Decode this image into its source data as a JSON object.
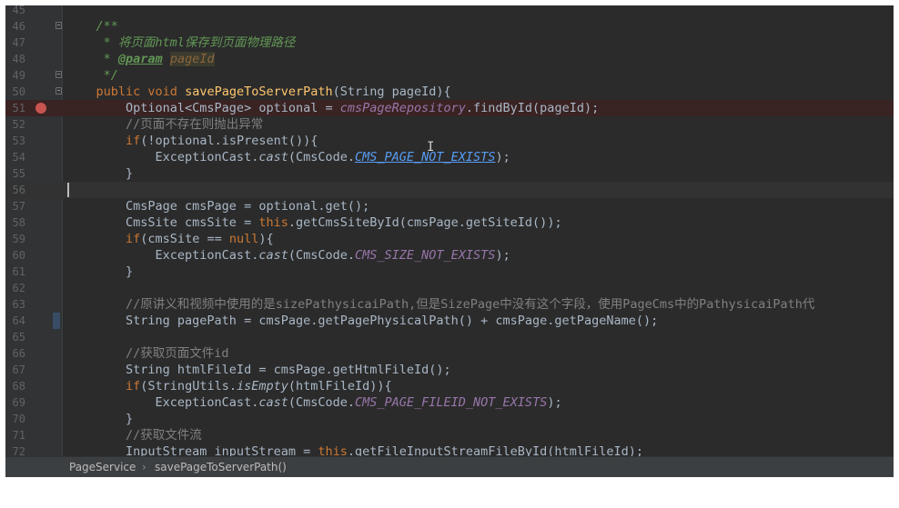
{
  "editor": {
    "lines": [
      {
        "n": "45",
        "tokens": []
      },
      {
        "n": "46",
        "tokens": [
          [
            "    ",
            ""
          ],
          [
            "/**",
            "doc"
          ]
        ]
      },
      {
        "n": "47",
        "tokens": [
          [
            "     ",
            ""
          ],
          [
            "* 将页面html保存到页面物理路径",
            "doc"
          ]
        ]
      },
      {
        "n": "48",
        "tokens": [
          [
            "     ",
            ""
          ],
          [
            "* ",
            "doc"
          ],
          [
            "@param",
            "doc-tag"
          ],
          [
            " ",
            "doc"
          ],
          [
            "pageId",
            "doc-param"
          ]
        ]
      },
      {
        "n": "49",
        "tokens": [
          [
            "     ",
            ""
          ],
          [
            "*/",
            "doc"
          ]
        ]
      },
      {
        "n": "50",
        "tokens": [
          [
            "    ",
            ""
          ],
          [
            "public void ",
            "kw"
          ],
          [
            "savePageToServerPath",
            "fn"
          ],
          [
            "(String pageId){",
            ""
          ]
        ]
      },
      {
        "n": "51",
        "tokens": [
          [
            "        Optional<CmsPage> optional = ",
            ""
          ],
          [
            "cmsPageRepository",
            "st"
          ],
          [
            ".findById(pageId);",
            ""
          ]
        ]
      },
      {
        "n": "52",
        "tokens": [
          [
            "        ",
            ""
          ],
          [
            "//页面不存在则抛出异常",
            "cm"
          ]
        ]
      },
      {
        "n": "53",
        "tokens": [
          [
            "        ",
            ""
          ],
          [
            "if",
            "kw"
          ],
          [
            "(!optional.isPresent()){",
            ""
          ]
        ]
      },
      {
        "n": "54",
        "tokens": [
          [
            "            ExceptionCast.",
            ""
          ],
          [
            "cast",
            "it"
          ],
          [
            "(CmsCode.",
            ""
          ],
          [
            "CMS_PAGE_NOT_EXISTS",
            "st-link"
          ],
          [
            ");",
            ""
          ]
        ]
      },
      {
        "n": "55",
        "tokens": [
          [
            "        }",
            ""
          ]
        ]
      },
      {
        "n": "56",
        "tokens": []
      },
      {
        "n": "57",
        "tokens": [
          [
            "        CmsPage cmsPage = optional.get();",
            ""
          ]
        ]
      },
      {
        "n": "58",
        "tokens": [
          [
            "        CmsSite cmsSite = ",
            ""
          ],
          [
            "this",
            "kw"
          ],
          [
            ".getCmsSiteById(cmsPage.getSiteId());",
            ""
          ]
        ]
      },
      {
        "n": "59",
        "tokens": [
          [
            "        ",
            ""
          ],
          [
            "if",
            "kw"
          ],
          [
            "(cmsSite == ",
            ""
          ],
          [
            "null",
            "kw"
          ],
          [
            "){",
            ""
          ]
        ]
      },
      {
        "n": "60",
        "tokens": [
          [
            "            ExceptionCast.",
            ""
          ],
          [
            "cast",
            "it"
          ],
          [
            "(CmsCode.",
            ""
          ],
          [
            "CMS_SIZE_NOT_EXISTS",
            "st"
          ],
          [
            ");",
            ""
          ]
        ]
      },
      {
        "n": "61",
        "tokens": [
          [
            "        }",
            ""
          ]
        ]
      },
      {
        "n": "62",
        "tokens": []
      },
      {
        "n": "63",
        "tokens": [
          [
            "        ",
            ""
          ],
          [
            "//原讲义和视频中使用的是sizePathysicaiPath,但是SizePage中没有这个字段，使用PageCms中的PathysicaiPath代",
            "cm"
          ]
        ]
      },
      {
        "n": "64",
        "tokens": [
          [
            "        String pagePath = cmsPage.getPagePhysicalPath() + cmsPage.getPageName();",
            ""
          ]
        ]
      },
      {
        "n": "65",
        "tokens": []
      },
      {
        "n": "66",
        "tokens": [
          [
            "        ",
            ""
          ],
          [
            "//获取页面文件id",
            "cm"
          ]
        ]
      },
      {
        "n": "67",
        "tokens": [
          [
            "        String htmlFileId = cmsPage.getHtmlFileId();",
            ""
          ]
        ]
      },
      {
        "n": "68",
        "tokens": [
          [
            "        ",
            ""
          ],
          [
            "if",
            "kw"
          ],
          [
            "(StringUtils.",
            ""
          ],
          [
            "isEmpty",
            "it"
          ],
          [
            "(htmlFileId)){",
            ""
          ]
        ]
      },
      {
        "n": "69",
        "tokens": [
          [
            "            ExceptionCast.",
            ""
          ],
          [
            "cast",
            "it"
          ],
          [
            "(CmsCode.",
            ""
          ],
          [
            "CMS_PAGE_FILEID_NOT_EXISTS",
            "st"
          ],
          [
            ");",
            ""
          ]
        ]
      },
      {
        "n": "70",
        "tokens": [
          [
            "        }",
            ""
          ]
        ]
      },
      {
        "n": "71",
        "tokens": [
          [
            "        ",
            ""
          ],
          [
            "//获取文件流",
            "cm"
          ]
        ]
      },
      {
        "n": "72",
        "tokens": [
          [
            "        InputStream inputStream = ",
            ""
          ],
          [
            "this",
            "kw"
          ],
          [
            ".getFileInputStreamFileById(htmlFileId);",
            ""
          ]
        ]
      }
    ],
    "breakpoint_line": "51",
    "current_line": "56",
    "changed_line": "64",
    "fold_lines": [
      "46",
      "49",
      "50"
    ]
  },
  "breadcrumb": {
    "items": [
      "PageService",
      "savePageToServerPath()"
    ],
    "separator": "›"
  }
}
